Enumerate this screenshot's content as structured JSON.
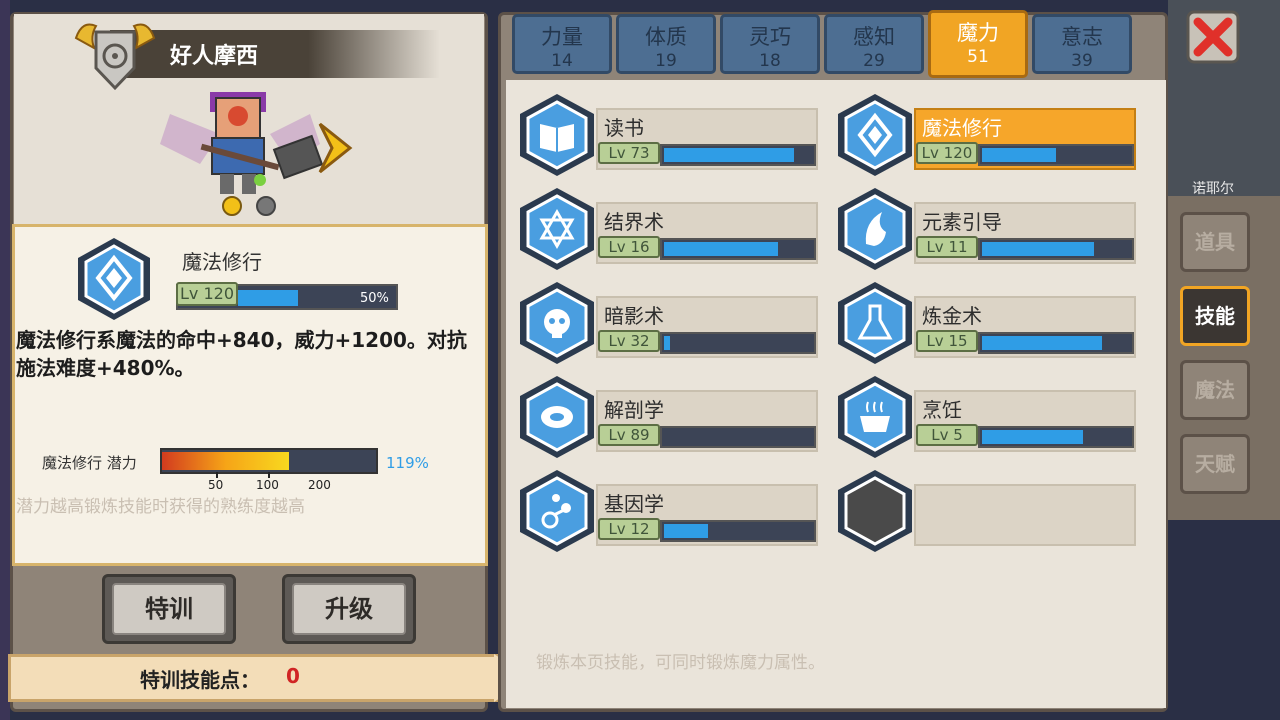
{
  "character": {
    "name": "好人摩西"
  },
  "selected_skill": {
    "name": "魔法修行",
    "level": "Lv 120",
    "progress_percent": 50,
    "progress_label": "50%",
    "description": "魔法修行系魔法的命中+840，威力+1200。对抗施法难度+480%。",
    "potential_label": "魔法修行 潜力",
    "potential_percent": 119,
    "potential_value_label": "119%",
    "potential_ticks": [
      "50",
      "100",
      "200"
    ],
    "hint": "潜力越高锻炼技能时获得的熟练度越高"
  },
  "buttons": {
    "train": "特训",
    "upgrade": "升级"
  },
  "points": {
    "label": "特训技能点：",
    "value": "0"
  },
  "tabs": [
    {
      "name": "力量",
      "value": "14",
      "active": false
    },
    {
      "name": "体质",
      "value": "19",
      "active": false
    },
    {
      "name": "灵巧",
      "value": "18",
      "active": false
    },
    {
      "name": "感知",
      "value": "29",
      "active": false
    },
    {
      "name": "魔力",
      "value": "51",
      "active": true
    },
    {
      "name": "意志",
      "value": "39",
      "active": false
    }
  ],
  "skills": [
    {
      "name": "读书",
      "level": "Lv 73",
      "progress": 0.88,
      "icon": "book-icon",
      "active": false
    },
    {
      "name": "魔法修行",
      "level": "Lv 120",
      "progress": 0.5,
      "icon": "magic-rune-icon",
      "active": true
    },
    {
      "name": "结界术",
      "level": "Lv 16",
      "progress": 0.77,
      "icon": "hexagram-icon",
      "active": false
    },
    {
      "name": "元素引导",
      "level": "Lv 11",
      "progress": 0.76,
      "icon": "element-icon",
      "active": false
    },
    {
      "name": "暗影术",
      "level": "Lv 32",
      "progress": 0.04,
      "icon": "skull-icon",
      "active": false
    },
    {
      "name": "炼金术",
      "level": "Lv 15",
      "progress": 0.81,
      "icon": "flask-icon",
      "active": false
    },
    {
      "name": "解剖学",
      "level": "Lv 89",
      "progress": 0.0,
      "icon": "meat-icon",
      "active": false
    },
    {
      "name": "烹饪",
      "level": "Lv 5",
      "progress": 0.68,
      "icon": "pot-icon",
      "active": false
    },
    {
      "name": "基因学",
      "level": "Lv 12",
      "progress": 0.3,
      "icon": "gene-icon",
      "active": false
    }
  ],
  "footer_hint": "锻炼本页技能，可同时锻炼魔力属性。",
  "side_menu": [
    {
      "label": "道具",
      "active": false
    },
    {
      "label": "技能",
      "active": true
    },
    {
      "label": "魔法",
      "active": false
    },
    {
      "label": "天赋",
      "active": false
    }
  ],
  "map_label": "诺耶尔"
}
